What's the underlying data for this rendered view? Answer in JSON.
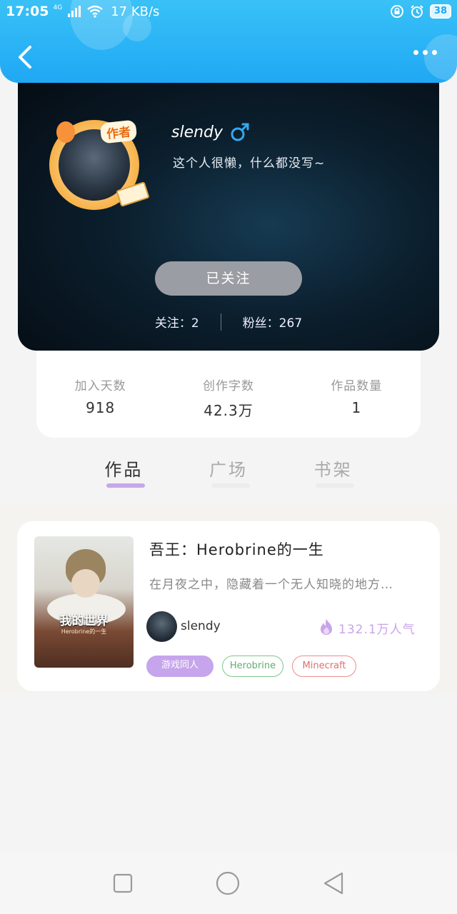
{
  "status_bar": {
    "time": "17:05",
    "network_type": "4G",
    "speed": "17 KB/s",
    "battery": "38"
  },
  "header": {
    "back_icon": "chevron-left-icon",
    "more_icon": "more-horizontal-icon"
  },
  "profile": {
    "author_badge": "作者",
    "username": "slendy",
    "gender_icon": "male-icon",
    "bio": "这个人很懒，什么都没写~",
    "follow_button": "已关注",
    "following_label": "关注：2",
    "fans_label": "粉丝：267"
  },
  "stats": [
    {
      "label": "加入天数",
      "value": "918"
    },
    {
      "label": "创作字数",
      "value": "42.3万"
    },
    {
      "label": "作品数量",
      "value": "1"
    }
  ],
  "tabs": [
    {
      "label": "作品",
      "active": true
    },
    {
      "label": "广场",
      "active": false
    },
    {
      "label": "书架",
      "active": false
    }
  ],
  "works": [
    {
      "cover_title": "我的世界",
      "cover_subtitle": "Herobrine的一生",
      "title": "吾王：Herobrine的一生",
      "description": "在月夜之中，隐藏着一个无人知晓的地方…",
      "author": "slendy",
      "popularity": "132.1万人气",
      "tags": [
        "游戏同人",
        "Herobrine",
        "Minecraft"
      ],
      "colors": {
        "tag_primary": "#c6a5ec",
        "tag_green": "#7cc78a",
        "tag_red": "#ec8d8d",
        "popularity": "#c9a4ea"
      }
    }
  ],
  "nav": {
    "recent_icon": "square-icon",
    "home_icon": "circle-icon",
    "back_icon": "triangle-back-icon"
  },
  "theme": {
    "header_color": "#1fa8f4",
    "accent": "#c7a7e9"
  }
}
